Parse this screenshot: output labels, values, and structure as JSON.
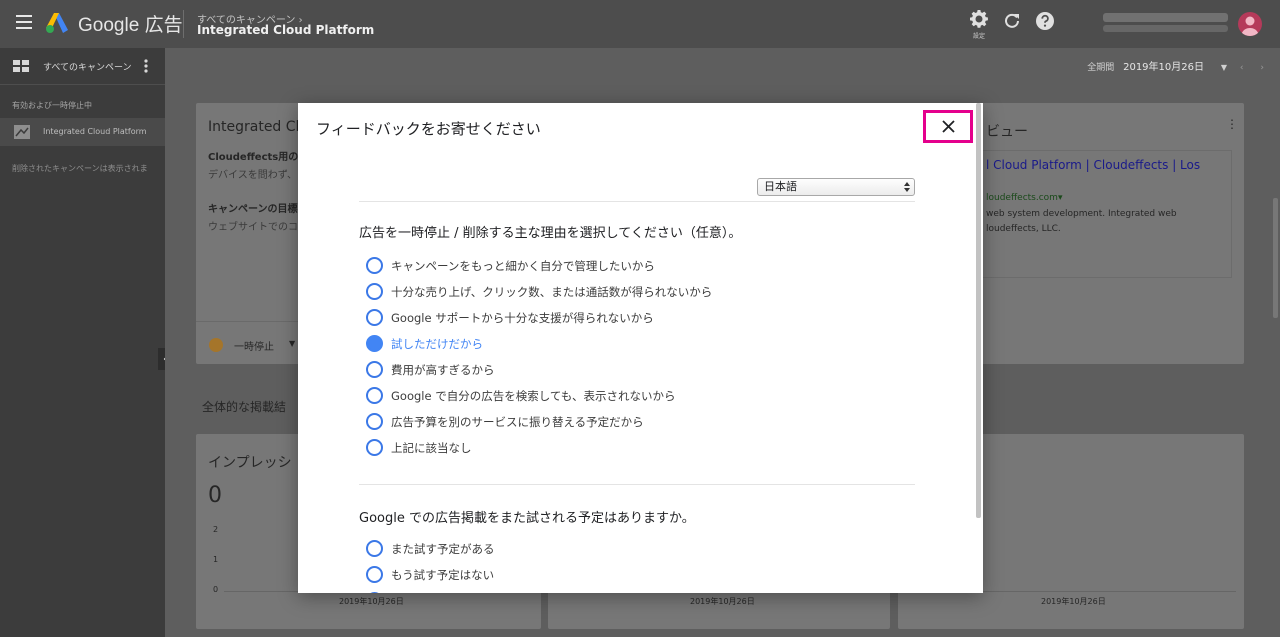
{
  "header": {
    "brand_google": "Google",
    "brand_ads": "広告",
    "breadcrumb_parent": "すべてのキャンペーン",
    "breadcrumb_current": "Integrated Cloud Platform",
    "settings_label": "設定"
  },
  "sidebar": {
    "all_campaigns": "すべてのキャンペーン",
    "section_label": "有効および一時停止中",
    "campaign": "Integrated Cloud Platform",
    "removed_note": "削除されたキャンペーンは表示されま"
  },
  "content": {
    "date_label": "全期間",
    "date_value": "2019年10月26日",
    "card1_title": "Integrated Clo",
    "card1_line1": "Cloudeffects用のキ",
    "card1_line2": "デバイスを問わず、",
    "card1_line3": "キャンペーンの目標",
    "card1_line4": "ウェブサイトでのコ",
    "pause_label": "一時停止",
    "card2_title": "ビュー",
    "ad_headline": "l Cloud Platform | Cloudeffects | Los",
    "ad_url": "loudeffects.com",
    "ad_desc1": "web system development. Integrated web",
    "ad_desc2": "loudeffects, LLC.",
    "section_heading": "全体的な掲載結",
    "impressions_label": "インプレッシ",
    "impressions_value": "0",
    "axis_2": "2",
    "axis_1": "1",
    "axis_0": "0",
    "axis_date1": "2019年10月26日",
    "axis_date2": "2019年10月26日",
    "axis_date3": "2019年10月26日"
  },
  "dialog": {
    "title": "フィードバックをお寄せください",
    "language": "日本語",
    "q1": "広告を一時停止 / 削除する主な理由を選択してください（任意）。",
    "q1_options": [
      "キャンペーンをもっと細かく自分で管理したいから",
      "十分な売り上げ、クリック数、または通話数が得られないから",
      "Google サポートから十分な支援が得られないから",
      "試しただけだから",
      "費用が高すぎるから",
      "Google で自分の広告を検索しても、表示されないから",
      "広告予算を別のサービスに振り替える予定だから",
      "上記に該当なし"
    ],
    "q1_selected_index": 3,
    "q2": "Google での広告掲載をまた試される予定はありますか。",
    "q2_options": [
      "また試す予定がある",
      "もう試す予定はない"
    ]
  },
  "colors": {
    "accent": "#4285f4",
    "highlight": "#e4008c"
  }
}
